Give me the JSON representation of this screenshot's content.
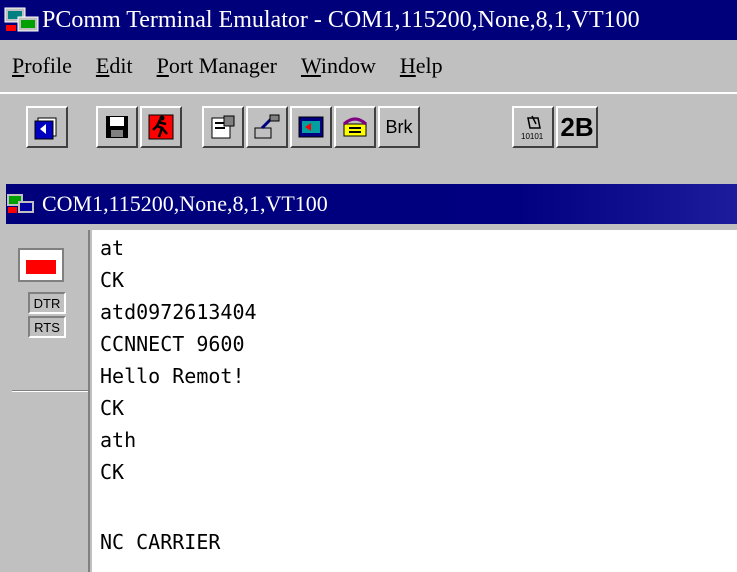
{
  "window": {
    "title": "PComm Terminal Emulator - COM1,115200,None,8,1,VT100",
    "app_icon": "pcomm-app-icon",
    "title_color": "#00007b"
  },
  "menu": {
    "items": [
      {
        "label": "Profile",
        "accel": "P"
      },
      {
        "label": "Edit",
        "accel": "E"
      },
      {
        "label": "Port Manager",
        "accel": "P"
      },
      {
        "label": "Window",
        "accel": "W"
      },
      {
        "label": "Help",
        "accel": "H"
      }
    ]
  },
  "toolbar": {
    "buttons": [
      {
        "name": "open-icon"
      },
      {
        "name": "save-icon"
      },
      {
        "name": "exit-icon"
      },
      {
        "name": "properties-icon"
      },
      {
        "name": "transfer-icon"
      },
      {
        "name": "capture-icon"
      },
      {
        "name": "dial-icon"
      },
      {
        "name": "break-button",
        "label": "Brk"
      },
      {
        "name": "binary-icon"
      },
      {
        "name": "2b-button",
        "label": "2B"
      }
    ]
  },
  "child_window": {
    "title": "COM1,115200,None,8,1,VT100"
  },
  "status": {
    "carrier_color": "#ff0000",
    "dtr_label": "DTR",
    "rts_label": "RTS"
  },
  "terminal": {
    "lines": [
      "at",
      "CK",
      "atd0972613404",
      "CCNNECT 9600",
      "Hello Remot!",
      "CK",
      "ath",
      "CK",
      "",
      "NC CARRIER"
    ]
  }
}
